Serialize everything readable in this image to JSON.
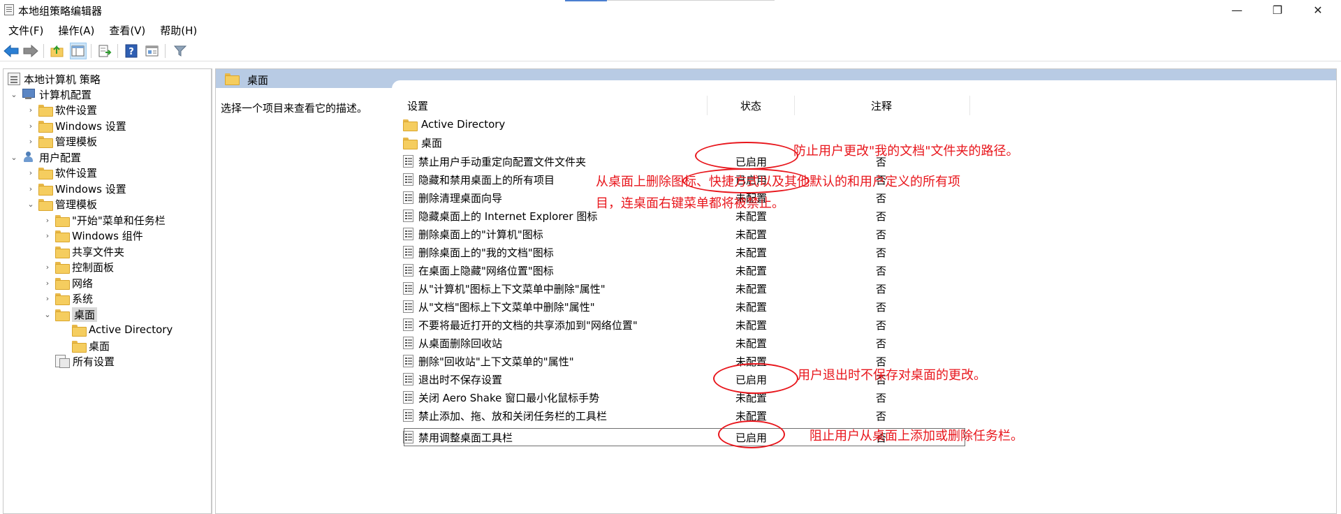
{
  "window": {
    "title": "本地组策略编辑器",
    "minimize_glyph": "—",
    "maximize_glyph": "❐",
    "close_glyph": "✕"
  },
  "menu": {
    "items": [
      "文件(F)",
      "操作(A)",
      "查看(V)",
      "帮助(H)"
    ]
  },
  "toolbar": {
    "icons": [
      "back-icon",
      "forward-icon",
      "up-folder-icon",
      "show-hide-tree-icon",
      "export-list-icon",
      "help-icon",
      "properties-icon",
      "filter-icon"
    ]
  },
  "tree": {
    "root": "本地计算机 策略",
    "computer_config": "计算机配置",
    "software_settings_1": "软件设置",
    "windows_settings_1": "Windows 设置",
    "admin_templates_1": "管理模板",
    "user_config": "用户配置",
    "software_settings_2": "软件设置",
    "windows_settings_2": "Windows 设置",
    "admin_templates_2": "管理模板",
    "start_menu": "\"开始\"菜单和任务栏",
    "windows_components": "Windows 组件",
    "shared_folders": "共享文件夹",
    "control_panel": "控制面板",
    "network": "网络",
    "system": "系统",
    "desktop": "桌面",
    "active_directory": "Active Directory",
    "desktop_sub": "桌面",
    "all_settings": "所有设置"
  },
  "right_pane": {
    "header_title": "桌面",
    "description": "选择一个项目来查看它的描述。",
    "columns": {
      "setting": "设置",
      "state": "状态",
      "comment": "注释"
    },
    "folders": [
      "Active Directory",
      "桌面"
    ],
    "rows": [
      {
        "name": "禁止用户手动重定向配置文件文件夹",
        "state": "已启用",
        "comment": "否"
      },
      {
        "name": "隐藏和禁用桌面上的所有项目",
        "state": "已启用",
        "comment": "否"
      },
      {
        "name": "删除清理桌面向导",
        "state": "未配置",
        "comment": "否"
      },
      {
        "name": "隐藏桌面上的 Internet Explorer 图标",
        "state": "未配置",
        "comment": "否"
      },
      {
        "name": "删除桌面上的\"计算机\"图标",
        "state": "未配置",
        "comment": "否"
      },
      {
        "name": "删除桌面上的\"我的文档\"图标",
        "state": "未配置",
        "comment": "否"
      },
      {
        "name": "在桌面上隐藏\"网络位置\"图标",
        "state": "未配置",
        "comment": "否"
      },
      {
        "name": "从\"计算机\"图标上下文菜单中删除\"属性\"",
        "state": "未配置",
        "comment": "否"
      },
      {
        "name": "从\"文档\"图标上下文菜单中删除\"属性\"",
        "state": "未配置",
        "comment": "否"
      },
      {
        "name": "不要将最近打开的文档的共享添加到\"网络位置\"",
        "state": "未配置",
        "comment": "否"
      },
      {
        "name": "从桌面删除回收站",
        "state": "未配置",
        "comment": "否"
      },
      {
        "name": "删除\"回收站\"上下文菜单的\"属性\"",
        "state": "未配置",
        "comment": "否"
      },
      {
        "name": "退出时不保存设置",
        "state": "已启用",
        "comment": "否"
      },
      {
        "name": "关闭 Aero Shake 窗口最小化鼠标手势",
        "state": "未配置",
        "comment": "否"
      },
      {
        "name": "禁止添加、拖、放和关闭任务栏的工具栏",
        "state": "未配置",
        "comment": "否"
      },
      {
        "name": "禁用调整桌面工具栏",
        "state": "已启用",
        "comment": "否"
      }
    ]
  },
  "annotations": {
    "note_1": "防止用户更改\"我的文档\"文件夹的路径。",
    "note_2_line1": "从桌面上删除图标、快捷方式以及其他默认的和用户定义的所有项",
    "note_2_line2": "目，连桌面右键菜单都将被禁止。",
    "note_3": "用户退出时不保存对桌面的更改。",
    "note_4": "阻止用户从桌面上添加或删除任务栏。",
    "color": "#e8161c"
  }
}
